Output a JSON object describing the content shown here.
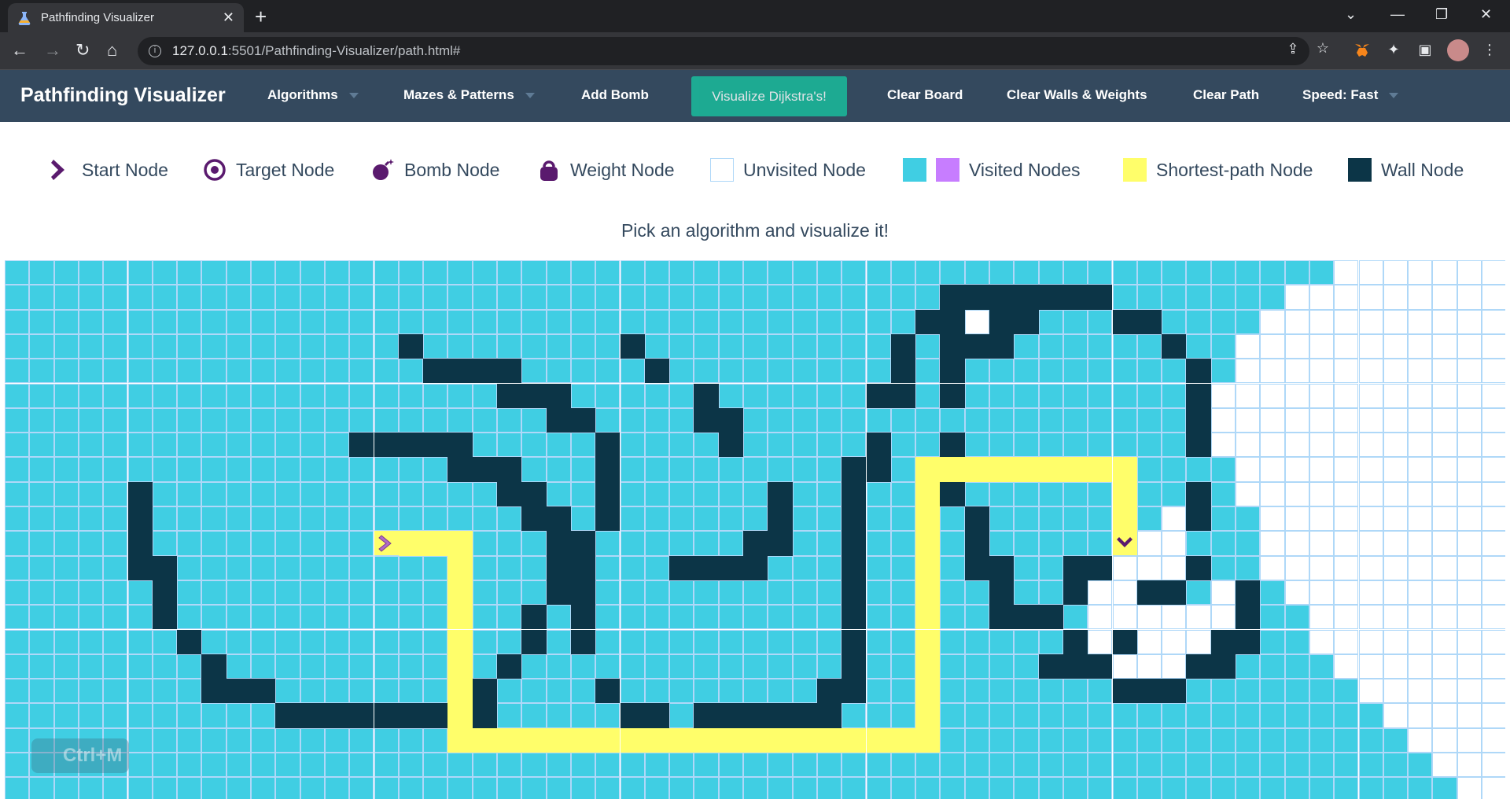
{
  "browser": {
    "tab_title": "Pathfinding Visualizer",
    "url_host": "127.0.0.1",
    "url_rest": ":5501/Pathfinding-Visualizer/path.html#"
  },
  "navbar": {
    "brand": "Pathfinding Visualizer",
    "algorithms": "Algorithms",
    "mazes": "Mazes & Patterns",
    "add_bomb": "Add Bomb",
    "visualize": "Visualize Dijkstra's!",
    "clear_board": "Clear Board",
    "clear_walls": "Clear Walls & Weights",
    "clear_path": "Clear Path",
    "speed": "Speed: Fast"
  },
  "legend": {
    "start": "Start Node",
    "target": "Target Node",
    "bomb": "Bomb Node",
    "weight": "Weight Node",
    "unvisited": "Unvisited Node",
    "visited": "Visited Nodes",
    "shortest": "Shortest-path Node",
    "wall": "Wall Node"
  },
  "instructions": "Pick an algorithm and visualize it!",
  "watermark": "Ctrl+M",
  "colors": {
    "navbar": "#34495e",
    "visualize_button": "#1abc9c",
    "visited": "#40cee3",
    "visited_alt": "#c77dff",
    "wall": "#0c3547",
    "path": "#fffe6a",
    "node_icon": "#5a1a6e"
  },
  "grid": {
    "cols": 61,
    "rows": 22,
    "start": [
      15,
      11
    ],
    "target": [
      45,
      11
    ],
    "walls": [
      [
        38,
        1
      ],
      [
        39,
        1
      ],
      [
        40,
        1
      ],
      [
        41,
        1
      ],
      [
        42,
        1
      ],
      [
        43,
        1
      ],
      [
        44,
        1
      ],
      [
        37,
        2
      ],
      [
        38,
        2
      ],
      [
        40,
        2
      ],
      [
        41,
        2
      ],
      [
        45,
        2
      ],
      [
        46,
        2
      ],
      [
        16,
        3
      ],
      [
        25,
        3
      ],
      [
        36,
        3
      ],
      [
        38,
        3
      ],
      [
        39,
        3
      ],
      [
        40,
        3
      ],
      [
        47,
        3
      ],
      [
        17,
        4
      ],
      [
        18,
        4
      ],
      [
        19,
        4
      ],
      [
        20,
        4
      ],
      [
        26,
        4
      ],
      [
        36,
        4
      ],
      [
        38,
        4
      ],
      [
        48,
        4
      ],
      [
        20,
        5
      ],
      [
        21,
        5
      ],
      [
        22,
        5
      ],
      [
        28,
        5
      ],
      [
        35,
        5
      ],
      [
        36,
        5
      ],
      [
        38,
        5
      ],
      [
        48,
        5
      ],
      [
        22,
        6
      ],
      [
        23,
        6
      ],
      [
        28,
        6
      ],
      [
        29,
        6
      ],
      [
        48,
        6
      ],
      [
        14,
        7
      ],
      [
        15,
        7
      ],
      [
        16,
        7
      ],
      [
        17,
        7
      ],
      [
        18,
        7
      ],
      [
        24,
        7
      ],
      [
        29,
        7
      ],
      [
        35,
        7
      ],
      [
        38,
        7
      ],
      [
        48,
        7
      ],
      [
        18,
        8
      ],
      [
        19,
        8
      ],
      [
        20,
        8
      ],
      [
        24,
        8
      ],
      [
        34,
        8
      ],
      [
        35,
        8
      ],
      [
        5,
        9
      ],
      [
        20,
        9
      ],
      [
        21,
        9
      ],
      [
        24,
        9
      ],
      [
        31,
        9
      ],
      [
        34,
        9
      ],
      [
        38,
        9
      ],
      [
        48,
        9
      ],
      [
        5,
        10
      ],
      [
        21,
        10
      ],
      [
        22,
        10
      ],
      [
        24,
        10
      ],
      [
        31,
        10
      ],
      [
        34,
        10
      ],
      [
        39,
        10
      ],
      [
        48,
        10
      ],
      [
        5,
        11
      ],
      [
        22,
        11
      ],
      [
        23,
        11
      ],
      [
        30,
        11
      ],
      [
        31,
        11
      ],
      [
        34,
        11
      ],
      [
        39,
        11
      ],
      [
        5,
        12
      ],
      [
        6,
        12
      ],
      [
        22,
        12
      ],
      [
        23,
        12
      ],
      [
        27,
        12
      ],
      [
        28,
        12
      ],
      [
        29,
        12
      ],
      [
        30,
        12
      ],
      [
        34,
        12
      ],
      [
        39,
        12
      ],
      [
        40,
        12
      ],
      [
        43,
        12
      ],
      [
        44,
        12
      ],
      [
        48,
        12
      ],
      [
        6,
        13
      ],
      [
        22,
        13
      ],
      [
        23,
        13
      ],
      [
        34,
        13
      ],
      [
        40,
        13
      ],
      [
        43,
        13
      ],
      [
        46,
        13
      ],
      [
        47,
        13
      ],
      [
        50,
        13
      ],
      [
        6,
        14
      ],
      [
        21,
        14
      ],
      [
        23,
        14
      ],
      [
        34,
        14
      ],
      [
        40,
        14
      ],
      [
        41,
        14
      ],
      [
        42,
        14
      ],
      [
        50,
        14
      ],
      [
        7,
        15
      ],
      [
        21,
        15
      ],
      [
        23,
        15
      ],
      [
        34,
        15
      ],
      [
        43,
        15
      ],
      [
        45,
        15
      ],
      [
        49,
        15
      ],
      [
        50,
        15
      ],
      [
        8,
        16
      ],
      [
        20,
        16
      ],
      [
        34,
        16
      ],
      [
        42,
        16
      ],
      [
        43,
        16
      ],
      [
        44,
        16
      ],
      [
        48,
        16
      ],
      [
        49,
        16
      ],
      [
        8,
        17
      ],
      [
        9,
        17
      ],
      [
        10,
        17
      ],
      [
        19,
        17
      ],
      [
        24,
        17
      ],
      [
        33,
        17
      ],
      [
        34,
        17
      ],
      [
        45,
        17
      ],
      [
        46,
        17
      ],
      [
        47,
        17
      ],
      [
        11,
        18
      ],
      [
        12,
        18
      ],
      [
        13,
        18
      ],
      [
        14,
        18
      ],
      [
        15,
        18
      ],
      [
        16,
        18
      ],
      [
        17,
        18
      ],
      [
        19,
        18
      ],
      [
        25,
        18
      ],
      [
        26,
        18
      ],
      [
        28,
        18
      ],
      [
        29,
        18
      ],
      [
        30,
        18
      ],
      [
        31,
        18
      ],
      [
        32,
        18
      ],
      [
        33,
        18
      ]
    ],
    "path": [
      [
        16,
        11
      ],
      [
        17,
        11
      ],
      [
        18,
        11
      ],
      [
        18,
        12
      ],
      [
        18,
        13
      ],
      [
        18,
        14
      ],
      [
        18,
        15
      ],
      [
        18,
        16
      ],
      [
        18,
        17
      ],
      [
        18,
        18
      ],
      [
        18,
        19
      ],
      [
        19,
        19
      ],
      [
        20,
        19
      ],
      [
        21,
        19
      ],
      [
        22,
        19
      ],
      [
        23,
        19
      ],
      [
        24,
        19
      ],
      [
        25,
        19
      ],
      [
        26,
        19
      ],
      [
        27,
        19
      ],
      [
        28,
        19
      ],
      [
        29,
        19
      ],
      [
        30,
        19
      ],
      [
        31,
        19
      ],
      [
        32,
        19
      ],
      [
        33,
        19
      ],
      [
        34,
        19
      ],
      [
        35,
        19
      ],
      [
        36,
        19
      ],
      [
        37,
        19
      ],
      [
        37,
        18
      ],
      [
        37,
        17
      ],
      [
        37,
        16
      ],
      [
        37,
        15
      ],
      [
        37,
        14
      ],
      [
        37,
        13
      ],
      [
        37,
        12
      ],
      [
        37,
        11
      ],
      [
        37,
        10
      ],
      [
        37,
        9
      ],
      [
        37,
        8
      ],
      [
        38,
        8
      ],
      [
        39,
        8
      ],
      [
        40,
        8
      ],
      [
        41,
        8
      ],
      [
        42,
        8
      ],
      [
        43,
        8
      ],
      [
        44,
        8
      ],
      [
        45,
        8
      ],
      [
        45,
        9
      ],
      [
        45,
        10
      ]
    ],
    "unvisited_extra": [
      [
        39,
        2
      ],
      [
        47,
        10
      ],
      [
        46,
        11
      ],
      [
        47,
        11
      ],
      [
        46,
        12
      ],
      [
        45,
        12
      ],
      [
        47,
        12
      ],
      [
        44,
        13
      ],
      [
        45,
        13
      ],
      [
        49,
        13
      ],
      [
        44,
        14
      ],
      [
        45,
        14
      ],
      [
        46,
        14
      ],
      [
        47,
        14
      ],
      [
        48,
        14
      ],
      [
        49,
        14
      ],
      [
        44,
        15
      ],
      [
        46,
        15
      ],
      [
        47,
        15
      ],
      [
        48,
        15
      ],
      [
        45,
        16
      ],
      [
        46,
        16
      ],
      [
        47,
        16
      ]
    ],
    "unvisited_frontier": [
      54,
      52,
      51,
      50,
      50,
      49,
      49,
      49,
      50,
      50,
      51,
      51,
      51,
      52,
      53,
      53,
      54,
      55,
      56,
      57,
      58,
      59
    ]
  }
}
